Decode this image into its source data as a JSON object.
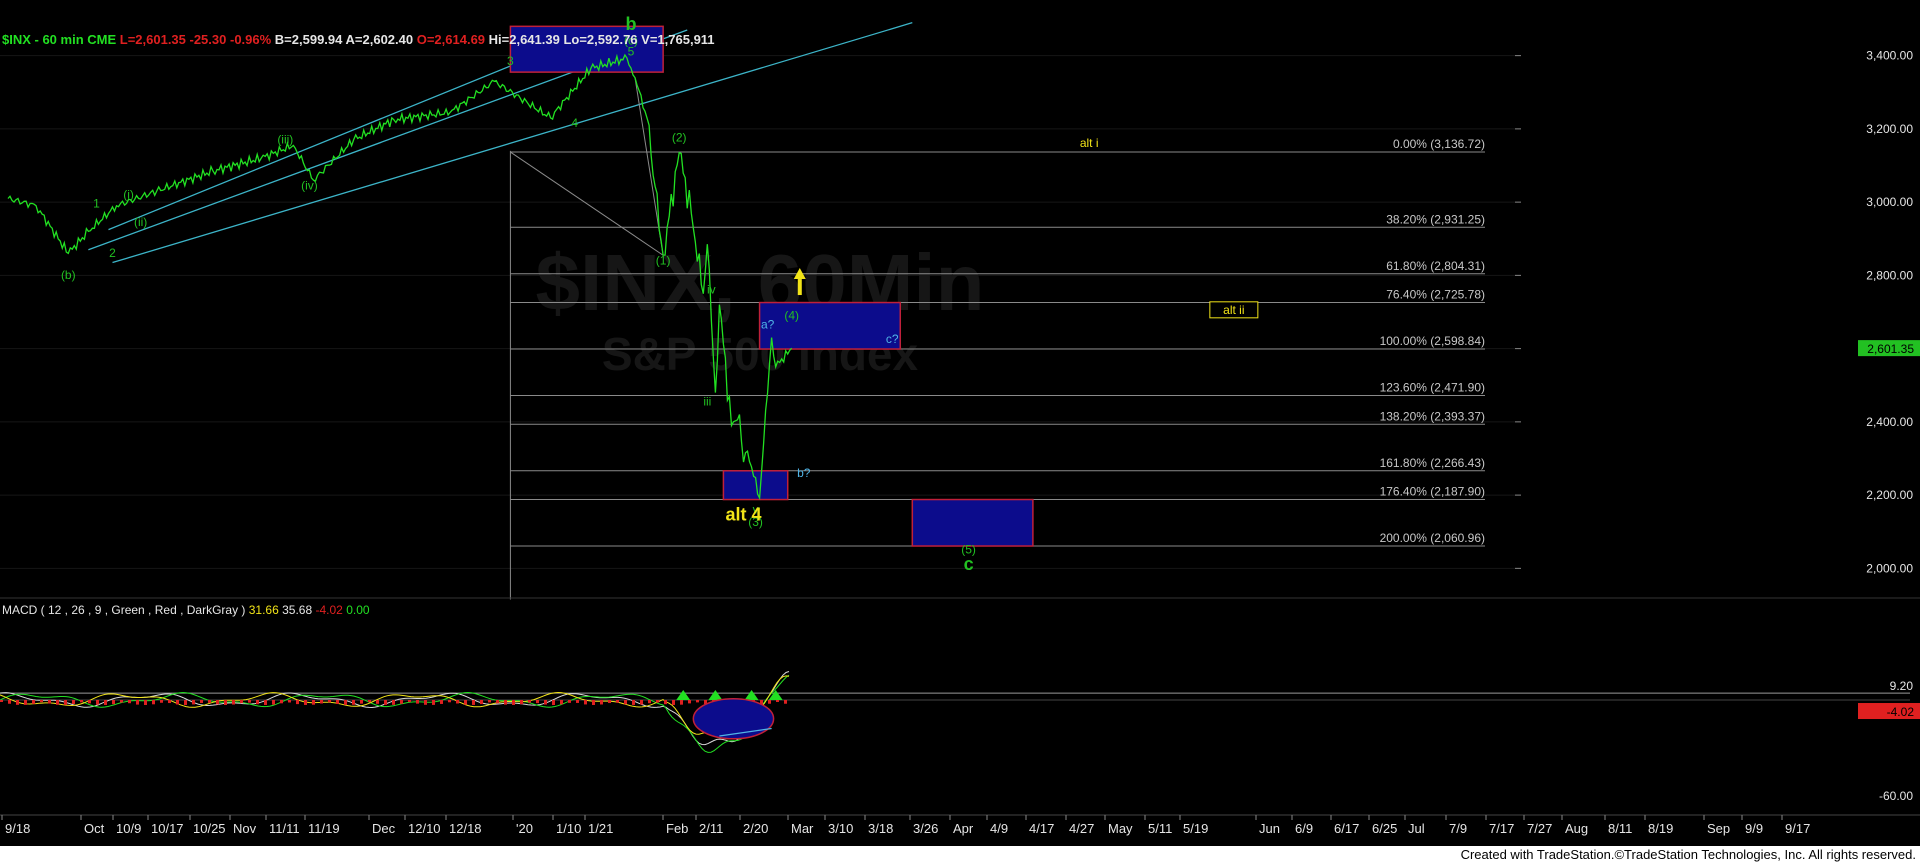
{
  "header": {
    "symbol_line": "$INX - 60 min  CME",
    "last": "L=2,601.35",
    "change": "-25.30",
    "change_pct": "-0.96%",
    "bid": "B=2,599.94",
    "ask": "A=2,602.40",
    "open": "O=2,614.69",
    "high": "Hi=2,641.39",
    "low": "Lo=2,592.76",
    "volume": "V=1,765,911"
  },
  "watermark": {
    "line1": "$INX, 60Min",
    "line2": "S&P 500 Index"
  },
  "footer_text": "Created with TradeStation.©TradeStation Technologies, Inc. All rights reserved.",
  "colors": {
    "background": "#000000",
    "price": "#22e022",
    "channel": "#3cb4c8",
    "fib_line": "#8a8a8a",
    "box_fill": "#0c0c8c",
    "box_border": "#c0203a",
    "label_green": "#22c022",
    "label_yellow": "#f2e418",
    "label_cyan": "#50b4e6",
    "last_price_tag": "#22c022",
    "macd_line": "#22e022",
    "signal_line": "#e02020",
    "histogram": "#9a9a9a",
    "macd_neg_tag": "#e02020"
  },
  "chart_data": [
    {
      "type": "line",
      "title": "$INX - 60 min",
      "series": [
        {
          "name": "$INX",
          "x": [
            "2019-09-18",
            "2019-09-25",
            "2019-10-03",
            "2019-10-08",
            "2019-10-15",
            "2019-10-25",
            "2019-11-08",
            "2019-11-20",
            "2019-11-28",
            "2019-12-03",
            "2019-12-13",
            "2019-12-23",
            "2020-01-06",
            "2020-01-17",
            "2020-01-31",
            "2020-02-10",
            "2020-02-19",
            "2020-02-21",
            "2020-02-24",
            "2020-02-28",
            "2020-03-03",
            "2020-03-06",
            "2020-03-09",
            "2020-03-10",
            "2020-03-12",
            "2020-03-13",
            "2020-03-16",
            "2020-03-18",
            "2020-03-19",
            "2020-03-20",
            "2020-03-23",
            "2020-03-25",
            "2020-03-26",
            "2020-03-27",
            "2020-03-31"
          ],
          "values": [
            3010,
            2990,
            2860,
            2920,
            2990,
            3030,
            3085,
            3120,
            3155,
            3060,
            3170,
            3225,
            3245,
            3330,
            3230,
            3365,
            3393,
            3340,
            3230,
            2855,
            3135,
            2970,
            2750,
            2885,
            2480,
            2720,
            2390,
            2420,
            2290,
            2320,
            2192,
            2480,
            2630,
            2550,
            2601
          ]
        }
      ],
      "xlabel": "",
      "ylabel": "",
      "ylim": [
        1960,
        3470
      ],
      "y_ticks": [
        "3,400.00",
        "3,200.00",
        "3,000.00",
        "2,800.00",
        "2,600.00",
        "2,400.00",
        "2,200.00",
        "2,000.00"
      ],
      "x_ticks": [
        "9/18",
        "Oct",
        "10/9",
        "10/17",
        "10/25",
        "Nov",
        "11/11",
        "11/19",
        "Dec",
        "12/10",
        "12/18",
        "'20",
        "1/10",
        "1/21",
        "Feb",
        "2/11",
        "2/20",
        "Mar",
        "3/10",
        "3/18",
        "3/26",
        "Apr",
        "4/9",
        "4/17",
        "4/27",
        "May",
        "5/11",
        "5/19",
        "Jun",
        "6/9",
        "6/17",
        "6/25",
        "Jul",
        "7/9",
        "7/17",
        "7/27",
        "Aug",
        "8/11",
        "8/19",
        "Sep",
        "9/9",
        "9/17"
      ],
      "last_price": "2,601.35",
      "fib_levels": [
        {
          "label": "0.00% (3,136.72)",
          "value": 3136.72
        },
        {
          "label": "38.20% (2,931.25)",
          "value": 2931.25
        },
        {
          "label": "61.80% (2,804.31)",
          "value": 2804.31
        },
        {
          "label": "76.40% (2,725.78)",
          "value": 2725.78
        },
        {
          "label": "100.00% (2,598.84)",
          "value": 2598.84
        },
        {
          "label": "123.60% (2,471.90)",
          "value": 2471.9
        },
        {
          "label": "138.20% (2,393.37)",
          "value": 2393.37
        },
        {
          "label": "161.80% (2,266.43)",
          "value": 2266.43
        },
        {
          "label": "176.40% (2,187.90)",
          "value": 2187.9
        },
        {
          "label": "200.00% (2,060.96)",
          "value": 2060.96
        }
      ],
      "target_boxes": [
        {
          "name": "top-box",
          "x": [
            "2020-01-21",
            "2020-02-28"
          ],
          "y": [
            3355,
            3480
          ]
        },
        {
          "name": "wave-4-box",
          "x": [
            "2020-03-23",
            "2020-04-27"
          ],
          "y": [
            2598.84,
            2725.78
          ]
        },
        {
          "name": "low-box",
          "x": [
            "2020-03-14",
            "2020-03-30"
          ],
          "y": [
            2187.9,
            2266.43
          ]
        },
        {
          "name": "wave-5-box",
          "x": [
            "2020-04-30",
            "2020-05-30"
          ],
          "y": [
            2060.96,
            2187.9
          ]
        }
      ],
      "channels": [
        {
          "x": [
            "2019-10-13",
            "2020-02-12"
          ],
          "y": [
            2925,
            3470
          ]
        },
        {
          "x": [
            "2019-10-08",
            "2020-03-05"
          ],
          "y": [
            2870,
            3470
          ]
        },
        {
          "x": [
            "2019-10-14",
            "2020-04-30"
          ],
          "y": [
            2835,
            3490
          ]
        }
      ],
      "annotations": [
        {
          "text": "b",
          "x": "2020-02-20",
          "y": 3470,
          "color": "green",
          "size": "large"
        },
        {
          "text": "(c)",
          "x": "2020-02-20",
          "y": 3430,
          "color": "green"
        },
        {
          "text": "5",
          "x": "2020-02-20",
          "y": 3400,
          "color": "green"
        },
        {
          "text": "3",
          "x": "2020-01-21",
          "y": 3375,
          "color": "green"
        },
        {
          "text": "4",
          "x": "2020-02-06",
          "y": 3205,
          "color": "green"
        },
        {
          "text": "(iii)",
          "x": "2019-11-26",
          "y": 3160,
          "color": "green"
        },
        {
          "text": "(iv)",
          "x": "2019-12-02",
          "y": 3035,
          "color": "green"
        },
        {
          "text": "(i)",
          "x": "2019-10-18",
          "y": 3010,
          "color": "green"
        },
        {
          "text": "(ii)",
          "x": "2019-10-21",
          "y": 2935,
          "color": "green"
        },
        {
          "text": "1",
          "x": "2019-10-10",
          "y": 2985,
          "color": "green"
        },
        {
          "text": "2",
          "x": "2019-10-14",
          "y": 2850,
          "color": "green"
        },
        {
          "text": "(b)",
          "x": "2019-10-03",
          "y": 2790,
          "color": "green"
        },
        {
          "text": "(2)",
          "x": "2020-03-03",
          "y": 3165,
          "color": "green"
        },
        {
          "text": "(1)",
          "x": "2020-02-28",
          "y": 2830,
          "color": "green"
        },
        {
          "text": "iv",
          "x": "2020-03-11",
          "y": 2750,
          "color": "green"
        },
        {
          "text": "iii",
          "x": "2020-03-10",
          "y": 2445,
          "color": "green"
        },
        {
          "text": "v",
          "x": "2020-03-22",
          "y": 2150,
          "color": "green"
        },
        {
          "text": "(3)",
          "x": "2020-03-22",
          "y": 2115,
          "color": "green"
        },
        {
          "text": "(4)",
          "x": "2020-03-31",
          "y": 2680,
          "color": "green"
        },
        {
          "text": "(5)",
          "x": "2020-05-14",
          "y": 2040,
          "color": "green"
        },
        {
          "text": "c",
          "x": "2020-05-14",
          "y": 1995,
          "color": "green",
          "size": "large"
        },
        {
          "text": "a?",
          "x": "2020-03-25",
          "y": 2655,
          "color": "cyan"
        },
        {
          "text": "c?",
          "x": "2020-04-25",
          "y": 2615,
          "color": "cyan"
        },
        {
          "text": "b?",
          "x": "2020-04-03",
          "y": 2250,
          "color": "cyan"
        },
        {
          "text": "alt i",
          "x": "2020-06-13",
          "y": 3150,
          "color": "yellow"
        },
        {
          "text": "alt ii",
          "x": "2020-07-19",
          "y": 2695,
          "color": "yellow",
          "boxed": true
        },
        {
          "text": "alt 4",
          "x": "2020-03-19",
          "y": 2130,
          "color": "yellow",
          "size": "large"
        }
      ]
    },
    {
      "type": "line",
      "title": "MACD ( 12 , 26 , 9 , Green , Red , DarkGray )",
      "legend_values": [
        "31.66",
        "35.68",
        "-4.02",
        "0.00"
      ],
      "series": [
        {
          "name": "MACD",
          "x": [
            "2020-03-23",
            "2020-03-31"
          ],
          "values": [
            -55,
            31.66
          ]
        },
        {
          "name": "Signal",
          "x": [
            "2020-03-23",
            "2020-03-31"
          ],
          "values": [
            -48,
            35.68
          ]
        },
        {
          "name": "Histogram",
          "x": [
            "2020-03-31"
          ],
          "values": [
            -4.02
          ]
        }
      ],
      "ylim": [
        -70,
        40
      ],
      "y_ticks": [
        "9.20",
        "-60.00"
      ],
      "last_value_tag": "-4.02"
    }
  ]
}
